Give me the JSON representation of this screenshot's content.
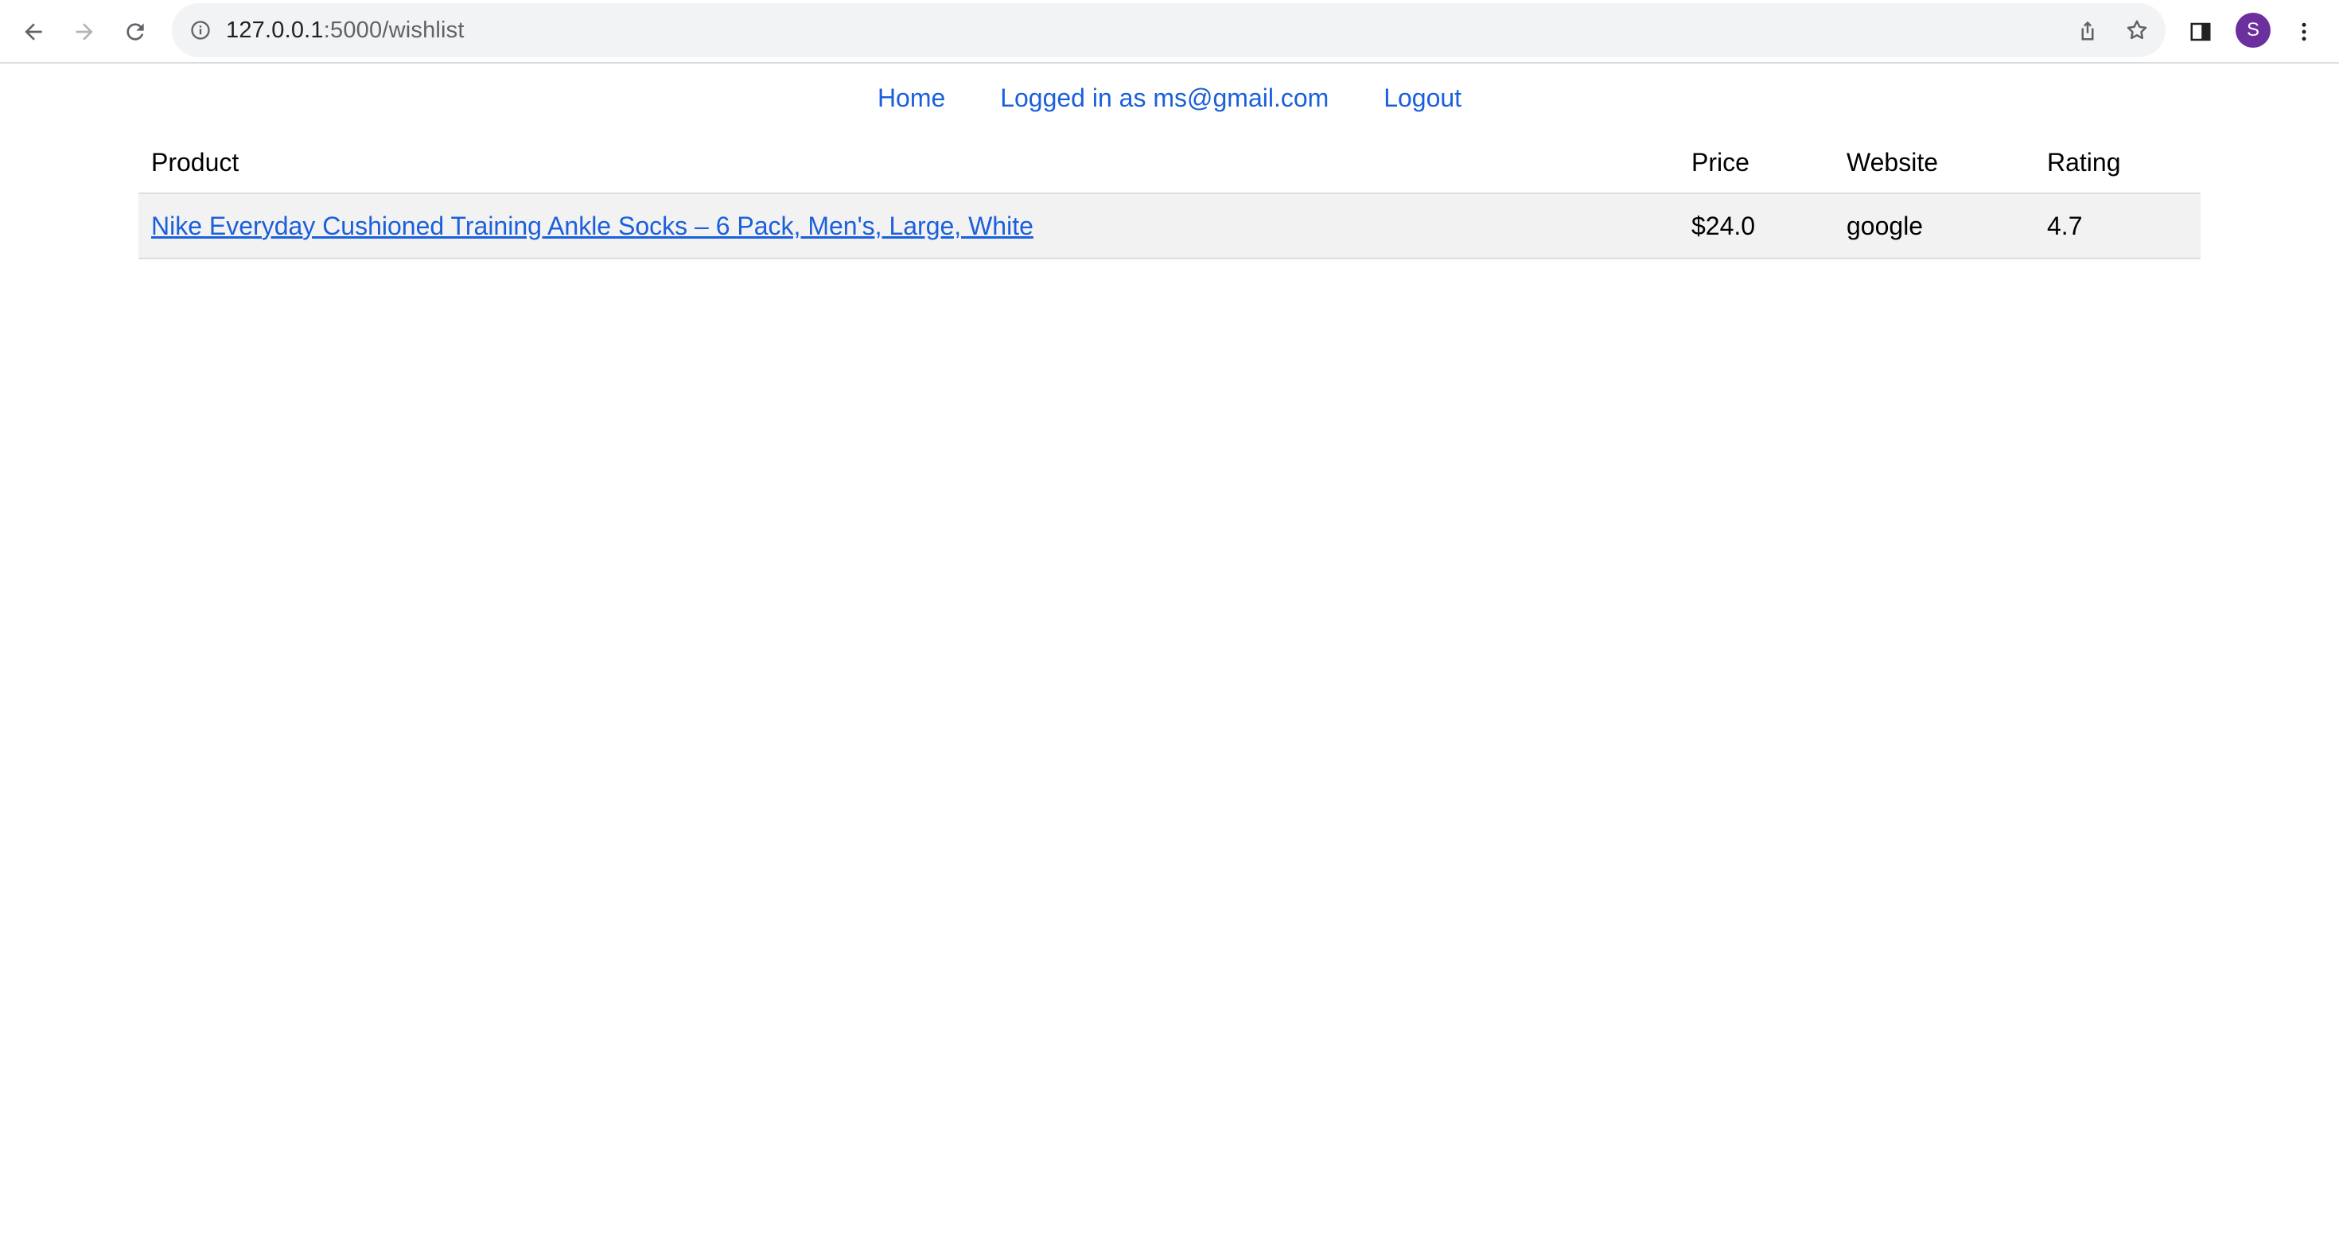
{
  "browser": {
    "url_host": "127.0.0.1",
    "url_path": ":5000/wishlist",
    "profile_initial": "S",
    "profile_color": "#6b2f9e",
    "icons": {
      "back": "back-arrow-icon",
      "forward": "forward-arrow-icon",
      "reload": "reload-icon",
      "site_info": "info-icon",
      "share": "share-icon",
      "bookmark": "star-icon",
      "side_panel": "side-panel-icon",
      "menu": "kebab-menu-icon"
    }
  },
  "nav": {
    "home": "Home",
    "logged_in": "Logged in as ms@gmail.com",
    "logout": "Logout"
  },
  "table": {
    "headers": {
      "product": "Product",
      "price": "Price",
      "website": "Website",
      "rating": "Rating"
    },
    "rows": [
      {
        "product": "Nike Everyday Cushioned Training Ankle Socks – 6 Pack, Men's, Large, White",
        "price": "$24.0",
        "website": "google",
        "rating": "4.7"
      }
    ]
  },
  "colors": {
    "link": "#1a5fdb",
    "row_background": "#f2f2f2"
  }
}
